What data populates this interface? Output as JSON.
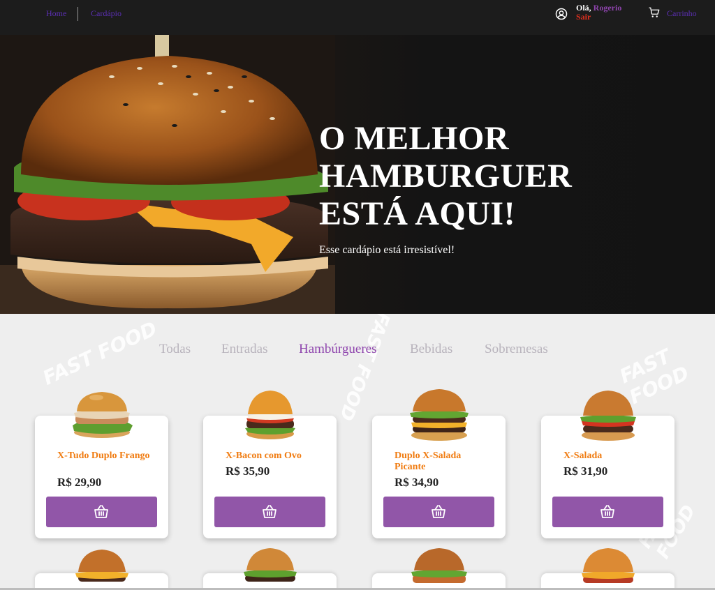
{
  "nav": {
    "home": "Home",
    "menu": "Cardápio",
    "cart": "Carrinho"
  },
  "user": {
    "greeting": "Olá,",
    "name": "Rogerio",
    "logout": "Sair"
  },
  "hero": {
    "title_lines": [
      "O MELHOR",
      "HAMBURGUER",
      "ESTÁ AQUI!"
    ],
    "subtitle": "Esse cardápio está irresistível!"
  },
  "tabs": [
    {
      "label": "Todas",
      "active": false
    },
    {
      "label": "Entradas",
      "active": false
    },
    {
      "label": "Hambúrgueres",
      "active": true
    },
    {
      "label": "Bebidas",
      "active": false
    },
    {
      "label": "Sobremesas",
      "active": false
    }
  ],
  "products": [
    {
      "name": "X-Tudo Duplo Frango",
      "price": "R$ 29,90",
      "icon": "burger-chicken-image"
    },
    {
      "name": "X-Bacon com Ovo",
      "price": "R$ 35,90",
      "icon": "burger-bacon-egg-image"
    },
    {
      "name": "Duplo X-Salada Picante",
      "price": "R$ 34,90",
      "icon": "burger-double-salad-image"
    },
    {
      "name": "X-Salada",
      "price": "R$ 31,90",
      "icon": "burger-salad-image"
    }
  ],
  "colors": {
    "accent": "#8e44ad",
    "button": "#9156a8",
    "product_name": "#f07c12",
    "logout": "#e0301e",
    "nav_link": "#5b2fb3",
    "topbar": "#1c1c1c"
  },
  "background_text": [
    "FAST FOOD",
    "FAST FOOD",
    "FAST FOOD",
    "FAST FOOD"
  ]
}
